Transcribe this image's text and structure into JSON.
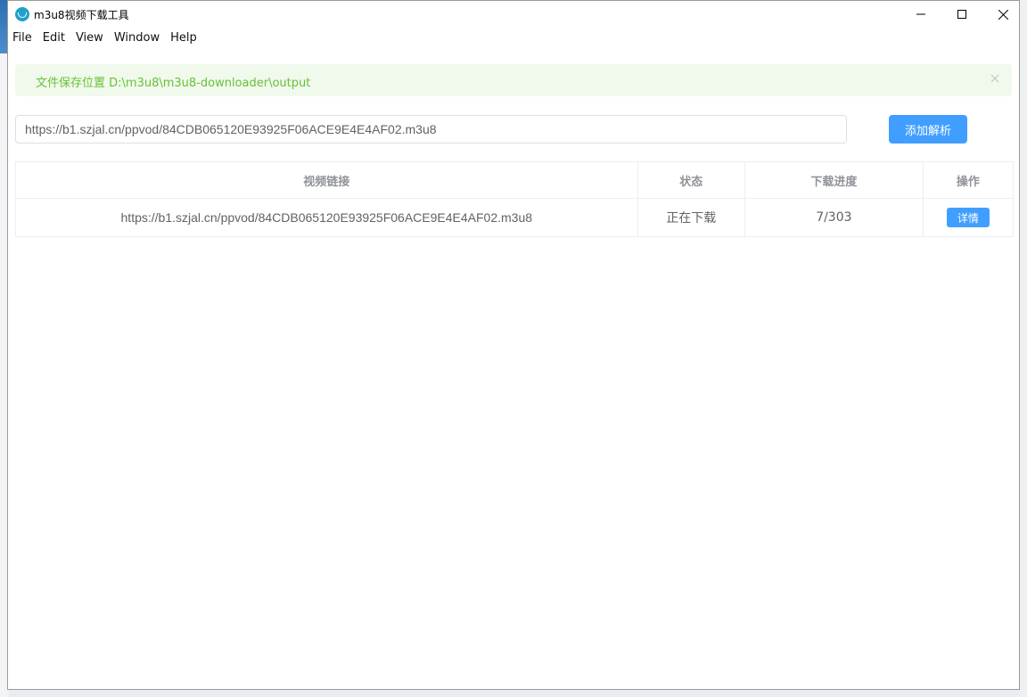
{
  "window": {
    "title": "m3u8视频下载工具"
  },
  "menubar": {
    "items": [
      "File",
      "Edit",
      "View",
      "Window",
      "Help"
    ]
  },
  "alert": {
    "message": "文件保存位置 D:\\m3u8\\m3u8-downloader\\output",
    "color": "#67c23a",
    "background": "#f0f9eb"
  },
  "url_input": {
    "value": "https://b1.szjal.cn/ppvod/84CDB065120E93925F06ACE9E4E4AF02.m3u8"
  },
  "add_button": {
    "label": "添加解析",
    "color": "#409eff"
  },
  "table": {
    "headers": {
      "url": "视频链接",
      "status": "状态",
      "progress": "下载进度",
      "action": "操作"
    },
    "rows": [
      {
        "url": "https://b1.szjal.cn/ppvod/84CDB065120E93925F06ACE9E4E4AF02.m3u8",
        "status": "正在下载",
        "progress": "7/303",
        "action_label": "详情"
      }
    ]
  }
}
